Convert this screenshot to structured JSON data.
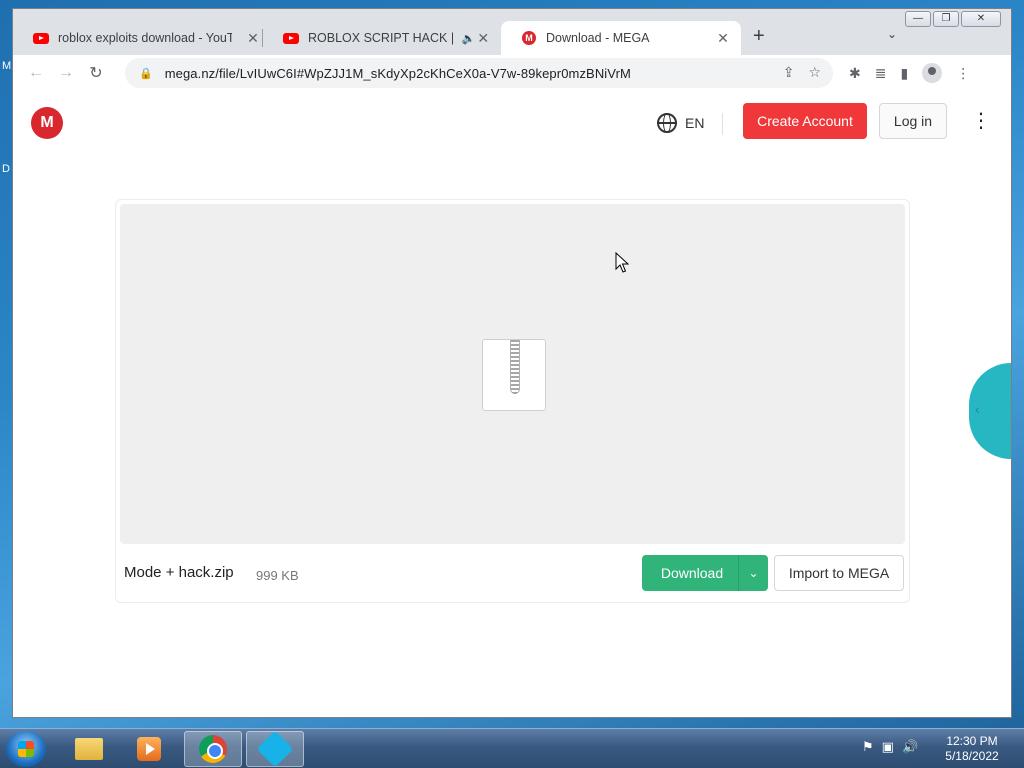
{
  "desktop": {
    "label_1": "M",
    "label_2": "D"
  },
  "window_controls": {
    "minimize": "—",
    "maximize": "❐",
    "close": "✕"
  },
  "browser": {
    "tabs": [
      {
        "title": "roblox exploits download - YouTube",
        "favicon": "youtube-icon"
      },
      {
        "title": "ROBLOX SCRIPT HACK | NEW",
        "favicon": "youtube-icon",
        "audio": "🔈"
      },
      {
        "title": "Download - MEGA",
        "favicon": "mega-icon",
        "active": true
      }
    ],
    "close_glyph": "✕",
    "new_tab": "+",
    "tab_search": "⌄",
    "address": {
      "url": "mega.nz/file/LvIUwC6I#WpZJJ1M_sKdyXp2cKhCeX0a-V7w-89kepr0mzBNiVrM",
      "lock_glyph": "🔒"
    },
    "nav": {
      "back": "←",
      "forward": "→",
      "reload": "↻"
    },
    "omni_icons": {
      "share": "⇪",
      "bookmark": "☆"
    },
    "toolbar_icons": {
      "extensions": "✱",
      "reading_list": "≣",
      "side_panel": "▮",
      "menu": "⋮"
    }
  },
  "mega": {
    "logo_letter": "M",
    "language": "EN",
    "create_account": "Create Account",
    "login": "Log in",
    "menu_glyph": "⋮",
    "file": {
      "name": "Mode + hack.zip",
      "size": "999 KB",
      "icon": "zip-file-icon"
    },
    "download_label": "Download",
    "download_caret": "⌄",
    "import_label": "Import to MEGA",
    "sidetab_glyph": "‹",
    "accent_color": "#d9272e",
    "download_color": "#30b47a"
  },
  "taskbar": {
    "time": "12:30 PM",
    "date": "5/18/2022",
    "tray_icons": [
      "flag-icon",
      "network-icon",
      "volume-icon"
    ],
    "tray_glyphs": {
      "flag": "⚑",
      "network": "▣",
      "volume": "🔊"
    }
  }
}
